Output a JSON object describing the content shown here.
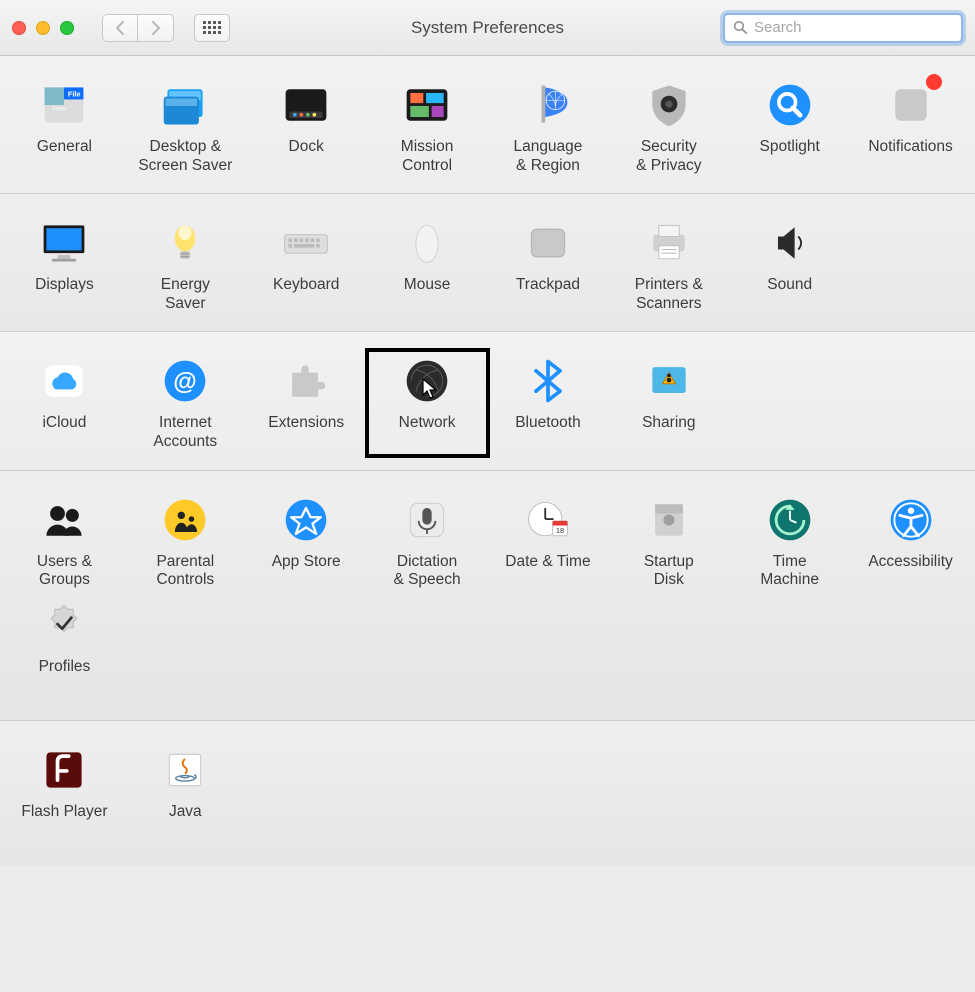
{
  "window_title": "System Preferences",
  "search": {
    "placeholder": "Search",
    "value": ""
  },
  "rows": [
    [
      {
        "id": "general",
        "label": "General"
      },
      {
        "id": "desktop",
        "label": "Desktop &\nScreen Saver"
      },
      {
        "id": "dock",
        "label": "Dock"
      },
      {
        "id": "mission",
        "label": "Mission\nControl"
      },
      {
        "id": "language",
        "label": "Language\n& Region"
      },
      {
        "id": "security",
        "label": "Security\n& Privacy"
      },
      {
        "id": "spotlight",
        "label": "Spotlight"
      },
      {
        "id": "notifications",
        "label": "Notifications",
        "badge": true
      }
    ],
    [
      {
        "id": "displays",
        "label": "Displays"
      },
      {
        "id": "energy",
        "label": "Energy\nSaver"
      },
      {
        "id": "keyboard",
        "label": "Keyboard"
      },
      {
        "id": "mouse",
        "label": "Mouse"
      },
      {
        "id": "trackpad",
        "label": "Trackpad"
      },
      {
        "id": "printers",
        "label": "Printers &\nScanners"
      },
      {
        "id": "sound",
        "label": "Sound"
      }
    ],
    [
      {
        "id": "icloud",
        "label": "iCloud"
      },
      {
        "id": "internet",
        "label": "Internet\nAccounts"
      },
      {
        "id": "extensions",
        "label": "Extensions"
      },
      {
        "id": "network",
        "label": "Network",
        "highlighted": true,
        "cursor": true
      },
      {
        "id": "bluetooth",
        "label": "Bluetooth"
      },
      {
        "id": "sharing",
        "label": "Sharing"
      }
    ],
    [
      {
        "id": "users",
        "label": "Users &\nGroups"
      },
      {
        "id": "parental",
        "label": "Parental\nControls"
      },
      {
        "id": "appstore",
        "label": "App Store"
      },
      {
        "id": "dictation",
        "label": "Dictation\n& Speech"
      },
      {
        "id": "datetime",
        "label": "Date & Time"
      },
      {
        "id": "startup",
        "label": "Startup\nDisk"
      },
      {
        "id": "timemachine",
        "label": "Time\nMachine"
      },
      {
        "id": "accessibility",
        "label": "Accessibility"
      },
      {
        "id": "profiles",
        "label": "Profiles"
      }
    ],
    [
      {
        "id": "flash",
        "label": "Flash Player"
      },
      {
        "id": "java",
        "label": "Java"
      }
    ]
  ]
}
